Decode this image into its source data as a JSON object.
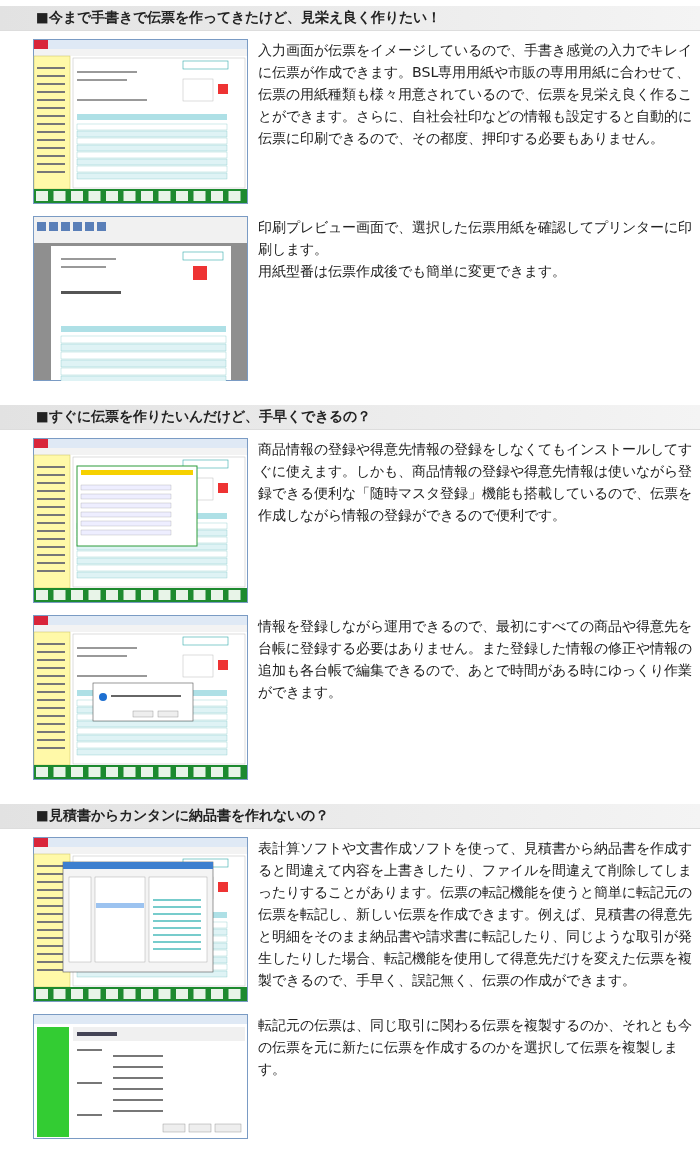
{
  "sections": [
    {
      "heading": "■今まで手書きで伝票を作ってきたけど、見栄え良く作りたい！",
      "rows": [
        {
          "screenshot": {
            "kind": "form"
          },
          "text": "入力画面が伝票をイメージしているので、手書き感覚の入力でキレイに伝票が作成できます。BSL専用用紙や市販の専用用紙に合わせて、伝票の用紙種類も様々用意されているので、伝票を見栄え良く作ることができます。さらに、自社会社印などの情報も設定すると自動的に伝票に印刷できるので、その都度、押印する必要もありません。"
        },
        {
          "screenshot": {
            "kind": "preview"
          },
          "text": "印刷プレビュー画面で、選択した伝票用紙を確認してプリンターに印刷します。",
          "note": "用紙型番は伝票作成後でも簡単に変更できます。"
        }
      ]
    },
    {
      "heading": "■すぐに伝票を作りたいんだけど、手早くできるの？",
      "rows": [
        {
          "screenshot": {
            "kind": "form-panel"
          },
          "text": "商品情報の登録や得意先情報の登録をしなくてもインストールしてすぐに使えます。しかも、商品情報の登録や得意先情報は使いながら登録できる便利な「随時マスタ登録」機能も搭載しているので、伝票を作成しながら情報の登録ができるので便利です。"
        },
        {
          "screenshot": {
            "kind": "form-message"
          },
          "text": "情報を登録しながら運用できるので、最初にすべての商品や得意先を台帳に登録する必要はありません。また登録した情報の修正や情報の追加も各台帳で編集できるので、あとで時間がある時にゆっくり作業ができます。"
        }
      ]
    },
    {
      "heading": "■見積書からカンタンに納品書を作れないの？",
      "rows": [
        {
          "screenshot": {
            "kind": "form-transfer"
          },
          "text": "表計算ソフトや文書作成ソフトを使って、見積書から納品書を作成すると間違えて内容を上書きしたり、ファイルを間違えて削除してしまったりすることがあります。伝票の転記機能を使うと簡単に転記元の伝票を転記し、新しい伝票を作成できます。例えば、見積書の得意先と明細をそのまま納品書や請求書に転記したり、同じような取引が発生したりした場合、転記機能を使用して得意先だけを変えた伝票を複製できるので、手早く、誤記無く、伝票の作成ができます。"
        },
        {
          "screenshot": {
            "kind": "settings"
          },
          "text": "転記元の伝票は、同じ取引に関わる伝票を複製するのか、それとも今の伝票を元に新たに伝票を作成するのかを選択して伝票を複製します。"
        }
      ]
    }
  ]
}
